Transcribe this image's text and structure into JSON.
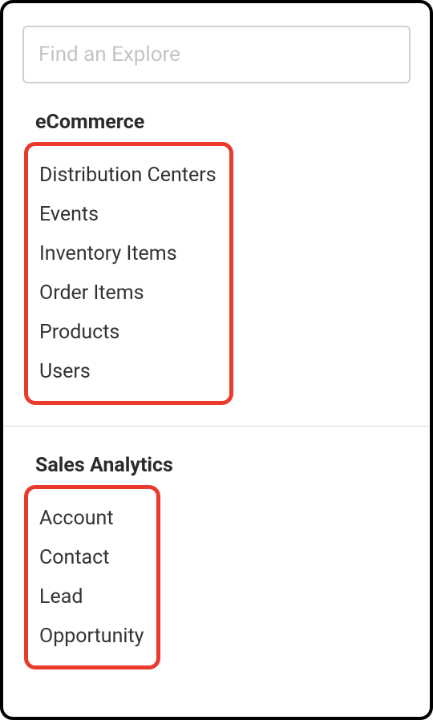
{
  "search": {
    "placeholder": "Find an Explore",
    "value": ""
  },
  "sections": [
    {
      "title": "eCommerce",
      "items": [
        "Distribution Centers",
        "Events",
        "Inventory Items",
        "Order Items",
        "Products",
        "Users"
      ]
    },
    {
      "title": "Sales Analytics",
      "items": [
        "Account",
        "Contact",
        "Lead",
        "Opportunity"
      ]
    }
  ]
}
